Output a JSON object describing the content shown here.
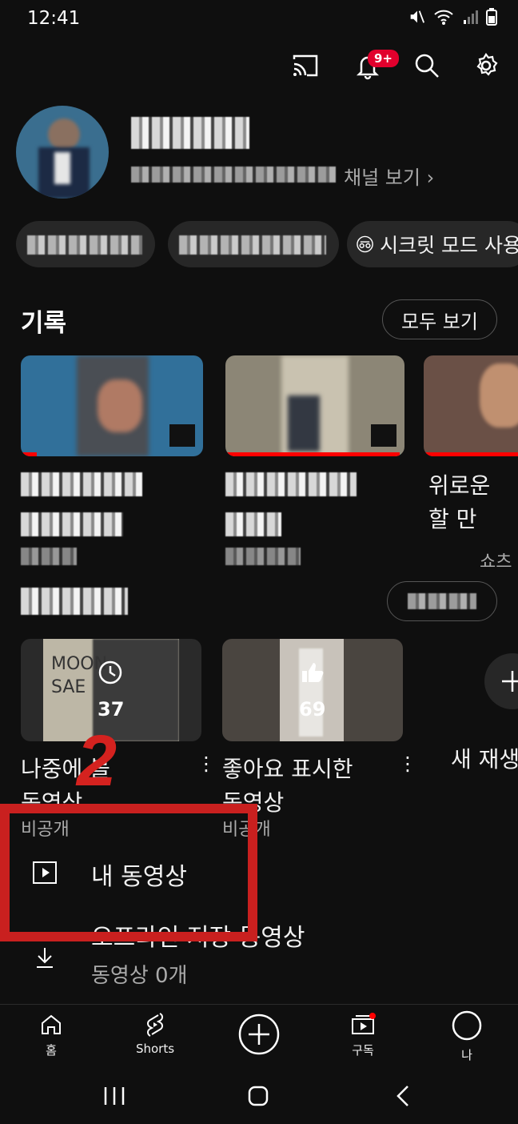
{
  "status": {
    "time": "12:41"
  },
  "top": {
    "notification_badge": "9+"
  },
  "profile": {
    "channel_link": "채널 보기 ›"
  },
  "pills": {
    "incognito": "시크릿 모드 사용"
  },
  "history": {
    "title": "기록",
    "see_all": "모두 보기"
  },
  "history_videos": [
    {
      "title_partial": "",
      "meta_partial": ""
    },
    {
      "title_partial": "",
      "meta_partial": ""
    },
    {
      "title_partial": "위로운\n할 만",
      "meta_partial": "쇼츠"
    }
  ],
  "playlists": [
    {
      "count": "37",
      "title": "나중에 볼\n동영상",
      "privacy": "비공개"
    },
    {
      "count": "69",
      "title": "좋아요 표시한\n동영상",
      "privacy": "비공개"
    },
    {
      "title": "새 재생"
    }
  ],
  "list": {
    "my_videos": "내 동영상",
    "offline": "오프라인 저장 동영상",
    "offline_sub": "동영상 0개"
  },
  "annotation": {
    "step": "2"
  },
  "nav": {
    "home": "홈",
    "shorts": "Shorts",
    "subscriptions": "구독",
    "me": "나"
  }
}
